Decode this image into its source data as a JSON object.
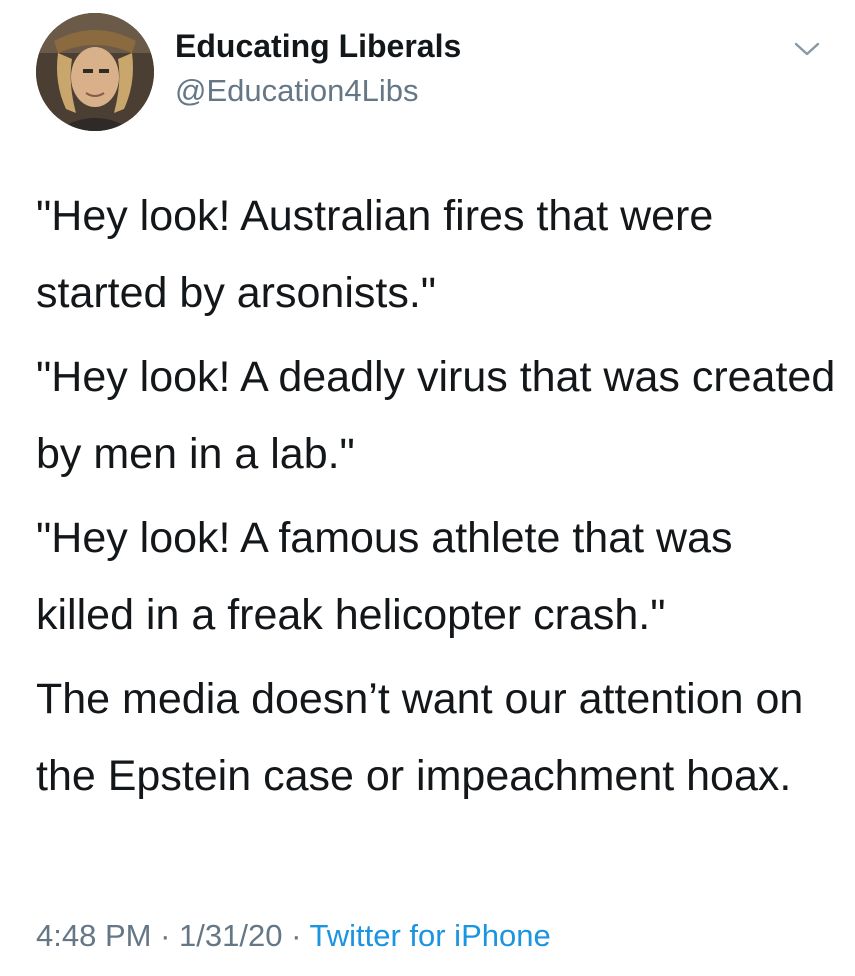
{
  "tweet": {
    "display_name": "Educating Liberals",
    "handle": "@Education4Libs",
    "paragraphs": [
      "\"Hey look! Australian fires that were started by arsonists.\"",
      "\"Hey look! A deadly virus that was created by men in a lab.\"",
      "\"Hey look! A famous athlete that was killed in a freak helicopter crash.\"",
      "The media doesn’t want our attention on the Epstein case or impeachment hoax."
    ],
    "time": "4:48 PM",
    "date": "1/31/20",
    "separator": "·",
    "source": "Twitter for iPhone"
  },
  "colors": {
    "text": "#14171a",
    "secondary": "#657786",
    "link": "#1b95e0",
    "background": "#ffffff"
  },
  "icons": {
    "avatar": "user-photo",
    "menu": "chevron-down-icon"
  }
}
